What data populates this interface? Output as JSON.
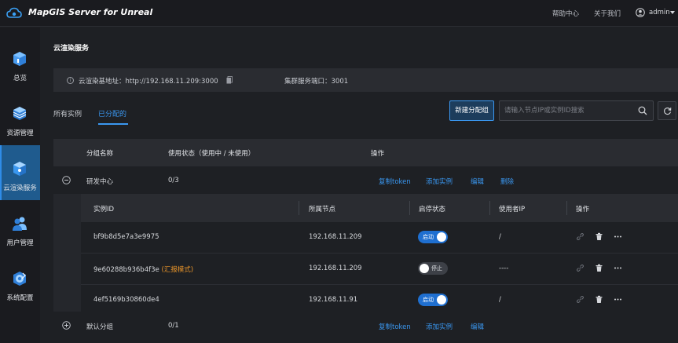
{
  "app": {
    "title": "MapGIS Server for Unreal"
  },
  "topbar": {
    "help": "帮助中心",
    "about": "关于我们",
    "user": "admin"
  },
  "sidebar": {
    "items": [
      {
        "label": "总览",
        "icon": "overview-icon",
        "active": false
      },
      {
        "label": "资源管理",
        "icon": "resource-icon",
        "active": false
      },
      {
        "label": "云渲染服务",
        "icon": "cloud-render-icon",
        "active": true
      },
      {
        "label": "用户管理",
        "icon": "users-icon",
        "active": false
      },
      {
        "label": "系统配置",
        "icon": "settings-icon",
        "active": false
      }
    ]
  },
  "page": {
    "title": "云渲染服务",
    "info": {
      "address": "云渲染基地址：http://192.168.11.209:3000",
      "port": "集群服务端口：3001"
    },
    "tabs": [
      {
        "label": "所有实例",
        "active": false
      },
      {
        "label": "已分配的",
        "active": true
      }
    ],
    "new_group_button": "新建分配组",
    "search": {
      "placeholder": "请输入节点IP或实例ID搜索",
      "value": ""
    }
  },
  "group_table": {
    "columns": [
      "分组名称",
      "使用状态（使用中 / 未使用）",
      "操作"
    ],
    "groups": [
      {
        "name": "研发中心",
        "usage": "0/3",
        "expanded": true,
        "actions": [
          "复制token",
          "添加实例",
          "编辑",
          "删除"
        ]
      },
      {
        "name": "默认分组",
        "usage": "0/1",
        "expanded": false,
        "actions": [
          "复制token",
          "添加实例",
          "编辑"
        ]
      }
    ]
  },
  "instance_table": {
    "columns": [
      "实例ID",
      "所属节点",
      "启停状态",
      "使用者IP",
      "操作"
    ],
    "rows": [
      {
        "id": "bf9b8d5e7a3e9975",
        "tag": "",
        "node": "192.168.11.209",
        "on": true,
        "status": "启动",
        "user_ip": "/"
      },
      {
        "id": "9e60288b936b4f3e",
        "tag": "(汇报模式)",
        "node": "192.168.11.209",
        "on": false,
        "status": "停止",
        "user_ip": "----"
      },
      {
        "id": "4ef5169b30860de4",
        "tag": "",
        "node": "192.168.11.91",
        "on": true,
        "status": "启动",
        "user_ip": "/"
      }
    ]
  },
  "colors": {
    "accent": "#3a97f0",
    "sidebar_active": "#1f5b8e",
    "switch_on": "#1f6fd0",
    "tag": "#e8942a"
  }
}
